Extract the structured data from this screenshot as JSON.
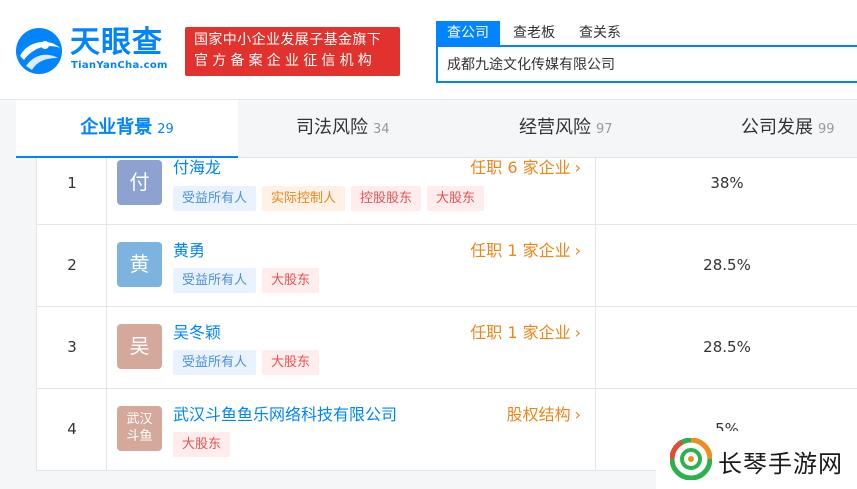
{
  "header": {
    "logo_name": "天眼查",
    "logo_domain": "TianYanCha.com",
    "slogan_line1": "国家中小企业发展子基金旗下",
    "slogan_line2": "官方备案企业征信机构",
    "search_tabs": [
      "查公司",
      "查老板",
      "查关系"
    ],
    "search_value": "成都九途文化传媒有限公司"
  },
  "main_tabs": [
    {
      "label": "企业背景",
      "count": "29"
    },
    {
      "label": "司法风险",
      "count": "34"
    },
    {
      "label": "经营风险",
      "count": "97"
    },
    {
      "label": "公司发展",
      "count": "99"
    }
  ],
  "shareholders": [
    {
      "index": "1",
      "avatar": "付",
      "name": "付海龙",
      "link": "任职 6 家企业",
      "tags": [
        "受益所有人",
        "实际控制人",
        "控股股东",
        "大股东"
      ],
      "percent": "38%"
    },
    {
      "index": "2",
      "avatar": "黄",
      "name": "黄勇",
      "link": "任职 1 家企业",
      "tags": [
        "受益所有人",
        "大股东"
      ],
      "percent": "28.5%"
    },
    {
      "index": "3",
      "avatar": "吴",
      "name": "吴冬颖",
      "link": "任职 1 家企业",
      "tags": [
        "受益所有人",
        "大股东"
      ],
      "percent": "28.5%"
    },
    {
      "index": "4",
      "avatar_line1": "武汉",
      "avatar_line2": "斗鱼",
      "name": "武汉斗鱼鱼乐网络科技有限公司",
      "link": "股权结构",
      "tags": [
        "大股东"
      ],
      "percent": "5%"
    }
  ],
  "watermark": {
    "text": "长琴手游网"
  },
  "colors": {
    "brand_blue": "#0084ff",
    "slogan_red": "#e2322d",
    "link_orange": "#f08519",
    "avatar_fu": "#8da2cf",
    "avatar_huang": "#7cb3df",
    "avatar_wu": "#d4a99b",
    "avatar_douyu": "#d4a99b"
  }
}
